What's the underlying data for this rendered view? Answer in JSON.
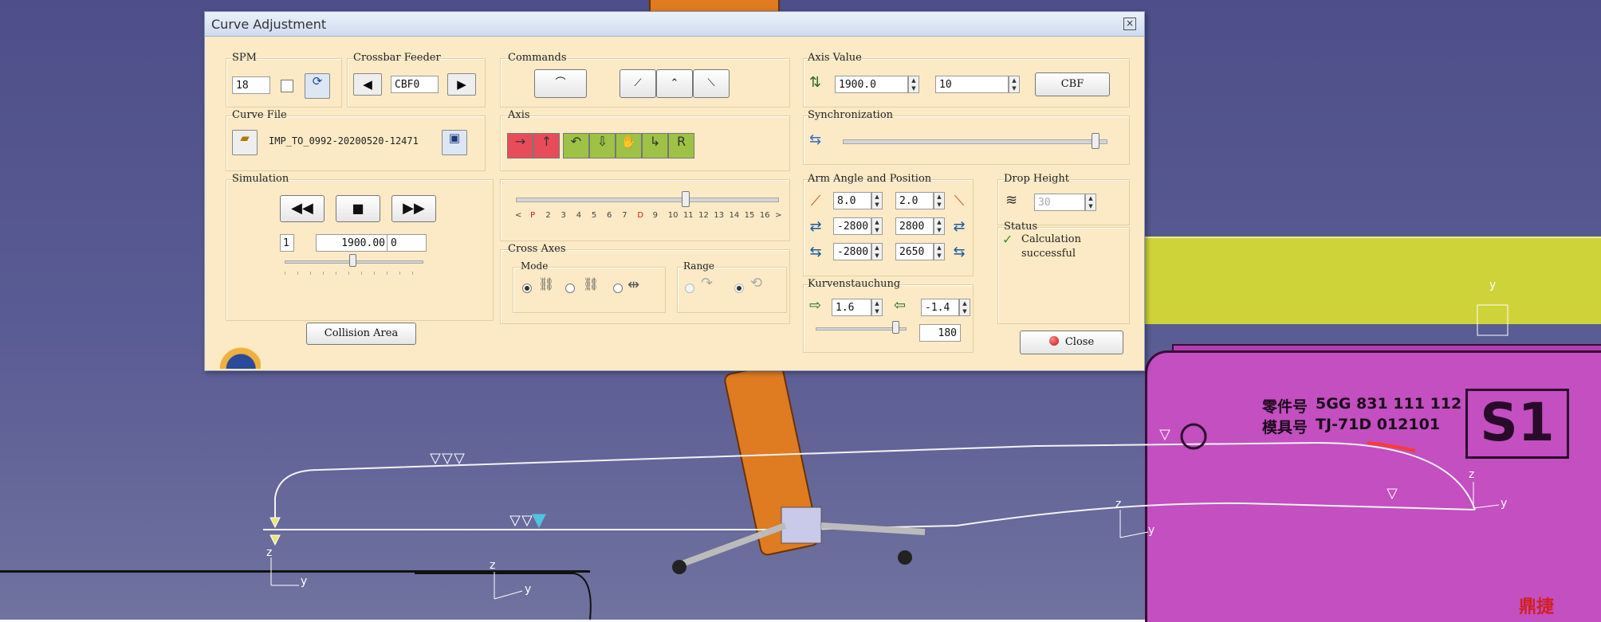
{
  "window": {
    "title": "Curve Adjustment"
  },
  "spm": {
    "label": "SPM",
    "value": "18"
  },
  "crossbar": {
    "label": "Crossbar Feeder",
    "value": "CBF0"
  },
  "commands": {
    "label": "Commands"
  },
  "axis_value": {
    "label": "Axis Value",
    "value1": "1900.0",
    "value2": "10",
    "button": "CBF"
  },
  "curve_file": {
    "label": "Curve File",
    "filename": "IMP_TO_0992-20200520-12471"
  },
  "axis": {
    "label": "Axis",
    "buttons": [
      "→",
      "↑",
      "↶",
      "⇩",
      "✋",
      "↳",
      "R"
    ]
  },
  "synchronization": {
    "label": "Synchronization",
    "level": 0.96
  },
  "simulation": {
    "label": "Simulation",
    "step": "1",
    "value": "1900.00",
    "offset": "0",
    "slider_level": 0.5
  },
  "timeline": {
    "ticks": [
      "<",
      "P",
      "2",
      "3",
      "4",
      "5",
      "6",
      "7",
      "D",
      "9",
      "10",
      "11",
      "12",
      "13",
      "14",
      "15",
      "16",
      ">"
    ],
    "red_ticks": [
      "P",
      "D"
    ],
    "level": 0.65
  },
  "cross_axes": {
    "label": "Cross Axes",
    "mode_label": "Mode",
    "range_label": "Range"
  },
  "arm": {
    "label": "Arm Angle and Position",
    "rows": [
      {
        "a": "8.0",
        "b": "2.0"
      },
      {
        "a": "-2800",
        "b": "2800"
      },
      {
        "a": "-2800",
        "b": "2650"
      }
    ]
  },
  "drop_height": {
    "label": "Drop Height",
    "value": "30"
  },
  "status": {
    "label": "Status",
    "message_line1": "Calculation",
    "message_line2": "successful",
    "icon": "check-icon"
  },
  "kurven": {
    "label": "Kurvenstauchung",
    "left": "1.6",
    "right": "-1.4",
    "slider_value": "180",
    "level": 0.9
  },
  "buttons": {
    "collision": "Collision Area",
    "close": "Close"
  },
  "scene": {
    "part_label": "零件号",
    "part_number": "5GG 831 111 112",
    "tool_label": "模具号",
    "tool_number": "TJ-71D 012101",
    "station": "S1",
    "watermark": "鼎捷"
  },
  "axes_labels": {
    "z": "z",
    "y": "y"
  },
  "colors": {
    "dialog_bg": "#fbeac5",
    "axis_button": "#9ec246",
    "axis_active": "#e74c5a",
    "machine": "#c34fc0",
    "band": "#cfd33a",
    "robot": "#df7b21"
  }
}
